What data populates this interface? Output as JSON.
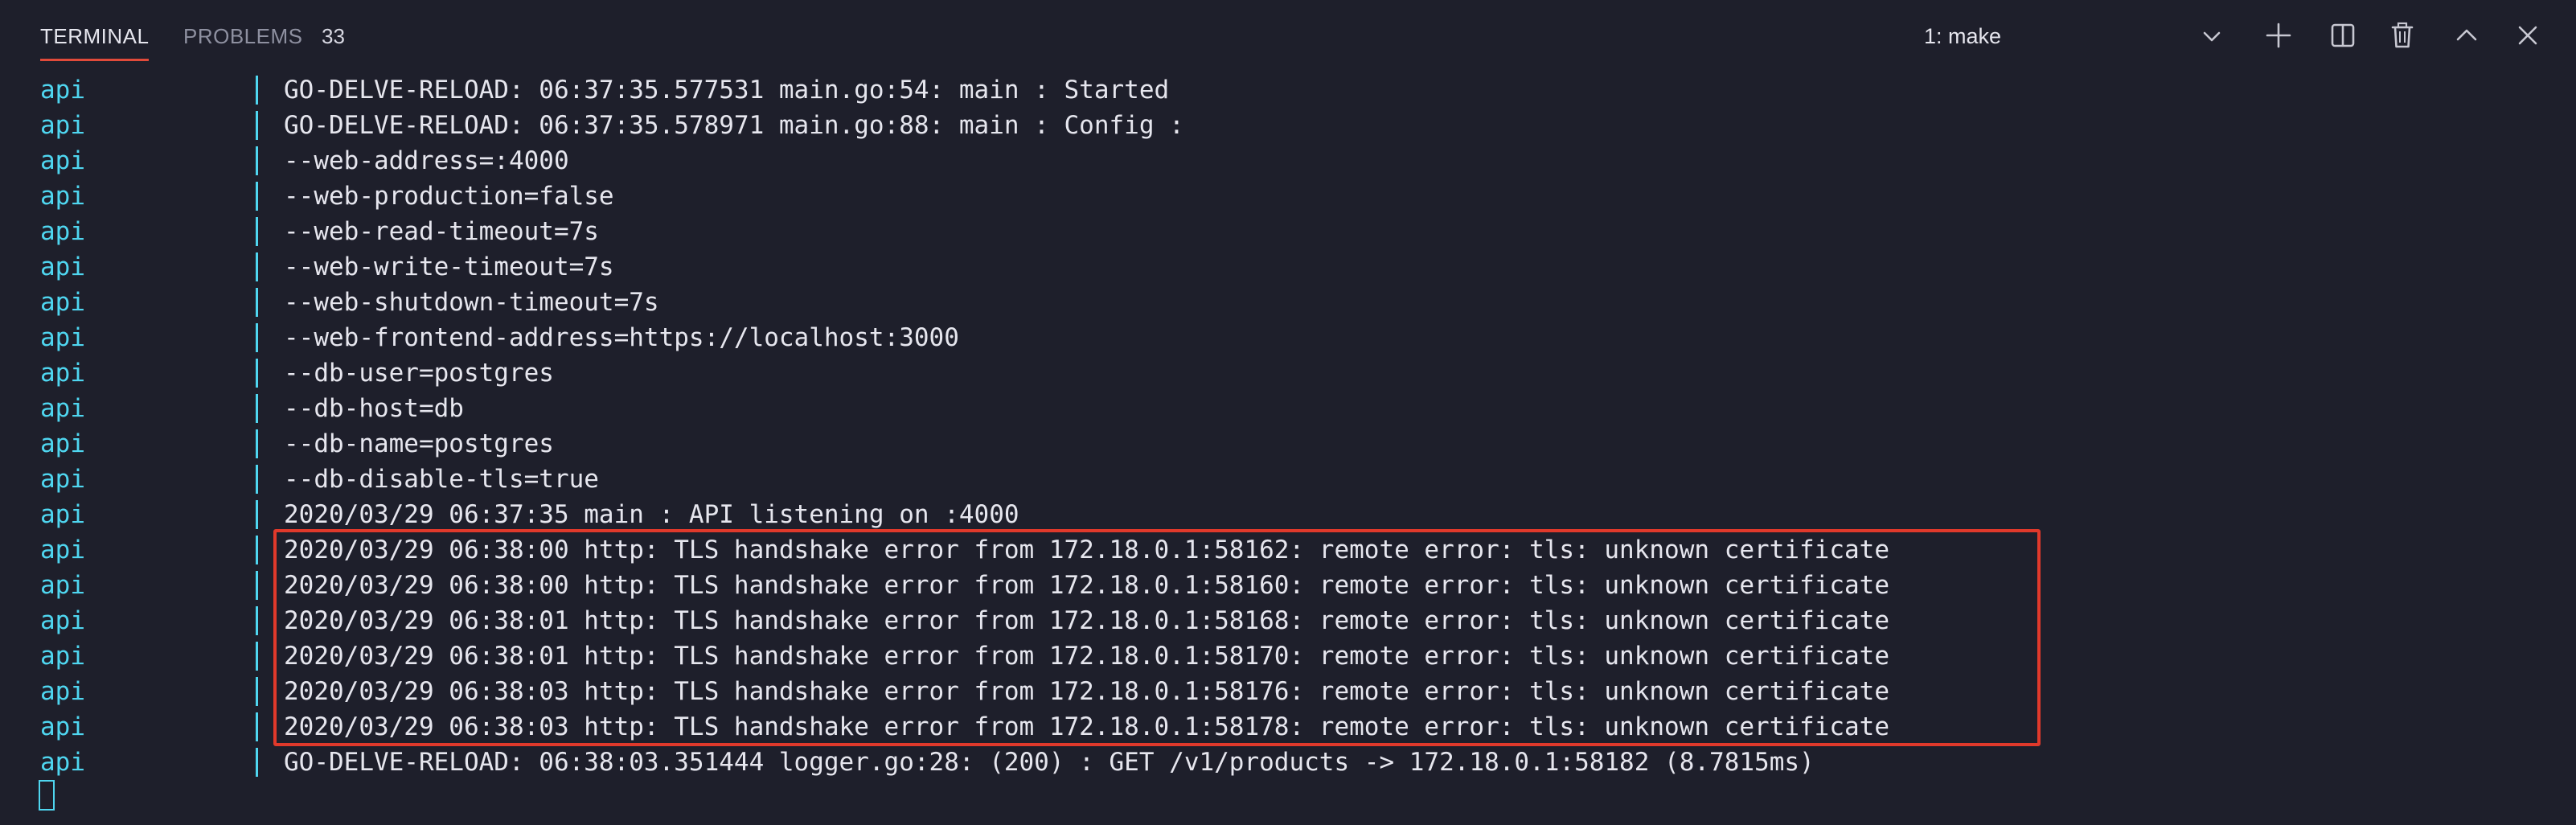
{
  "header": {
    "tabs": [
      {
        "label": "TERMINAL",
        "active": true
      },
      {
        "label": "PROBLEMS",
        "active": false
      }
    ],
    "problems_count": "33",
    "terminal_selector": {
      "selected": "1: make"
    },
    "icons": [
      "plus-icon",
      "split-icon",
      "trash-icon",
      "chevron-up-icon",
      "close-icon"
    ]
  },
  "terminal": {
    "lines": [
      {
        "svc": "api",
        "text": "GO-DELVE-RELOAD: 06:37:35.577531 main.go:54: main : Started"
      },
      {
        "svc": "api",
        "text": "GO-DELVE-RELOAD: 06:37:35.578971 main.go:88: main : Config :"
      },
      {
        "svc": "api",
        "text": "--web-address=:4000"
      },
      {
        "svc": "api",
        "text": "--web-production=false"
      },
      {
        "svc": "api",
        "text": "--web-read-timeout=7s"
      },
      {
        "svc": "api",
        "text": "--web-write-timeout=7s"
      },
      {
        "svc": "api",
        "text": "--web-shutdown-timeout=7s"
      },
      {
        "svc": "api",
        "text": "--web-frontend-address=https://localhost:3000"
      },
      {
        "svc": "api",
        "text": "--db-user=postgres"
      },
      {
        "svc": "api",
        "text": "--db-host=db"
      },
      {
        "svc": "api",
        "text": "--db-name=postgres"
      },
      {
        "svc": "api",
        "text": "--db-disable-tls=true"
      },
      {
        "svc": "api",
        "text": "2020/03/29 06:37:35 main : API listening on :4000"
      },
      {
        "svc": "api",
        "text": "2020/03/29 06:38:00 http: TLS handshake error from 172.18.0.1:58162: remote error: tls: unknown certificate"
      },
      {
        "svc": "api",
        "text": "2020/03/29 06:38:00 http: TLS handshake error from 172.18.0.1:58160: remote error: tls: unknown certificate"
      },
      {
        "svc": "api",
        "text": "2020/03/29 06:38:01 http: TLS handshake error from 172.18.0.1:58168: remote error: tls: unknown certificate"
      },
      {
        "svc": "api",
        "text": "2020/03/29 06:38:01 http: TLS handshake error from 172.18.0.1:58170: remote error: tls: unknown certificate"
      },
      {
        "svc": "api",
        "text": "2020/03/29 06:38:03 http: TLS handshake error from 172.18.0.1:58176: remote error: tls: unknown certificate"
      },
      {
        "svc": "api",
        "text": "2020/03/29 06:38:03 http: TLS handshake error from 172.18.0.1:58178: remote error: tls: unknown certificate"
      },
      {
        "svc": "api",
        "text": "GO-DELVE-RELOAD: 06:38:03.351444 logger.go:28: (200) : GET /v1/products -> 172.18.0.1:58182 (8.7815ms)"
      }
    ]
  },
  "colors": {
    "background": "#1e1f2b",
    "service_prefix": "#4fd6f0",
    "highlight_border": "#e0392b",
    "active_tab_underline": "#e14a3a",
    "text": "#e6e6ee"
  }
}
